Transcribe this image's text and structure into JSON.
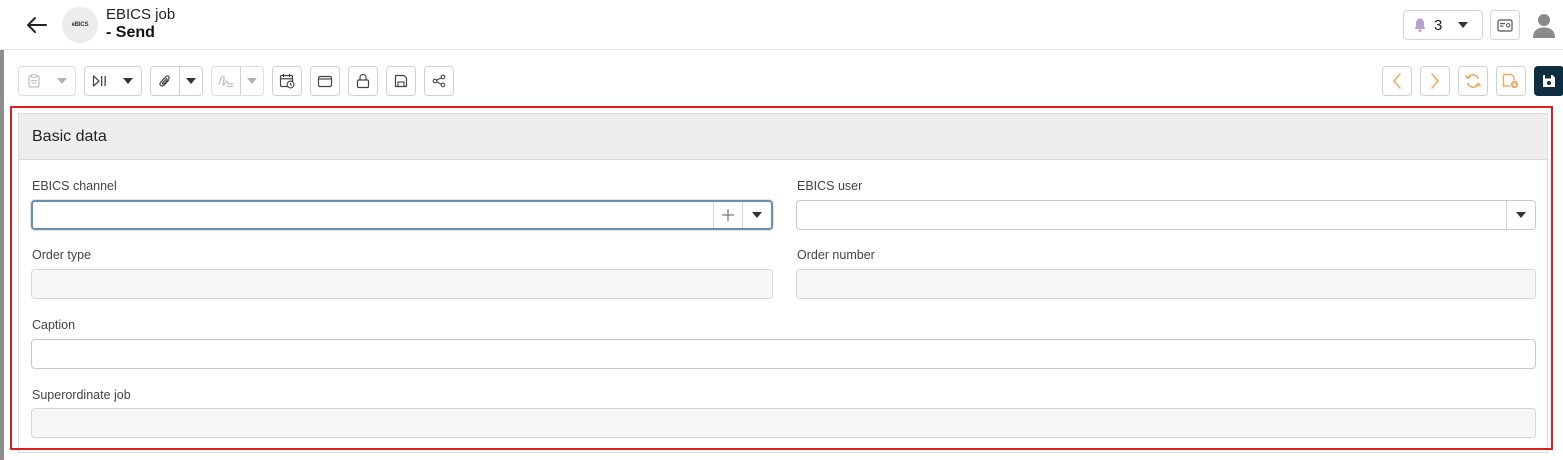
{
  "header": {
    "app_logo_text": "eBICS",
    "title": "EBICS job",
    "subtitle": "- Send",
    "notifications_count": "3"
  },
  "toolbar": {
    "icons": [
      "clipboard-icon",
      "play-pause-icon",
      "paperclip-icon",
      "signature-icon",
      "calendar-icon",
      "wallet-icon",
      "lock-icon",
      "save-outline-icon",
      "share-icon",
      "chevron-left-icon",
      "chevron-right-icon",
      "refresh-icon",
      "discard-icon",
      "save-icon"
    ],
    "colors": {
      "accent_orange": "#f0a860",
      "save_dark": "#0f2d40"
    }
  },
  "section": {
    "title": "Basic data",
    "fields": {
      "ebics_channel": {
        "label": "EBICS channel",
        "value": ""
      },
      "ebics_user": {
        "label": "EBICS user",
        "value": ""
      },
      "order_type": {
        "label": "Order type",
        "value": ""
      },
      "order_number": {
        "label": "Order number",
        "value": ""
      },
      "caption": {
        "label": "Caption",
        "value": ""
      },
      "superordinate_job": {
        "label": "Superordinate job",
        "value": ""
      }
    },
    "highlight_color": "#d92020"
  }
}
